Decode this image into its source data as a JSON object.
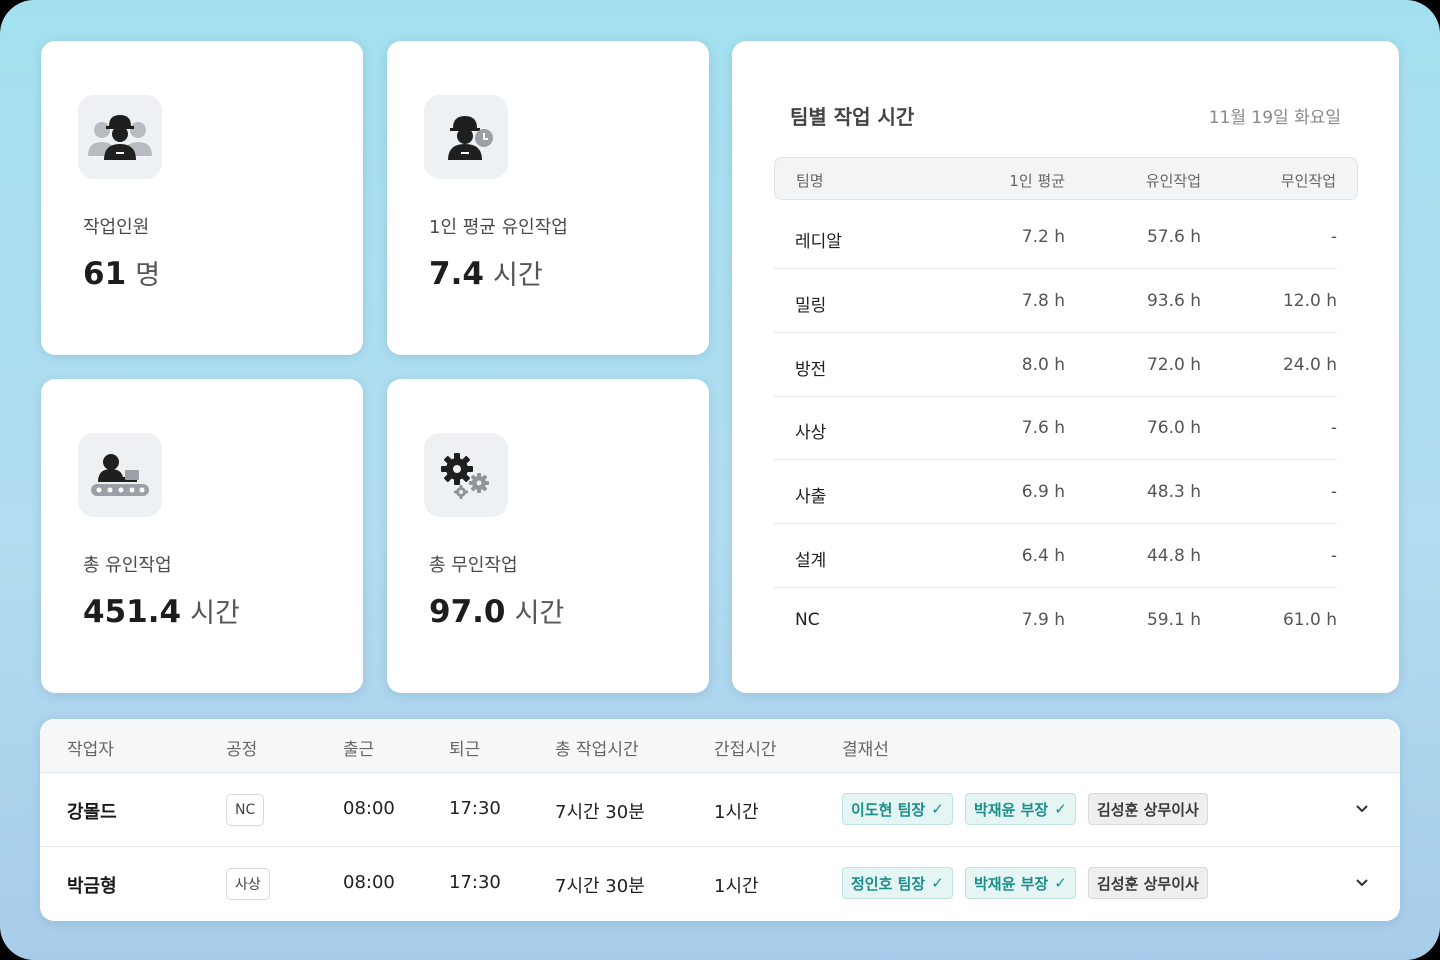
{
  "stats": [
    {
      "label": "작업인원",
      "value": "61",
      "unit": "명",
      "icon": "workers-group-icon"
    },
    {
      "label": "1인 평균 유인작업",
      "value": "7.4",
      "unit": "시간",
      "icon": "worker-clock-icon"
    },
    {
      "label": "총 유인작업",
      "value": "451.4",
      "unit": "시간",
      "icon": "worker-conveyor-icon"
    },
    {
      "label": "총 무인작업",
      "value": "97.0",
      "unit": "시간",
      "icon": "gears-icon"
    }
  ],
  "team_panel": {
    "title": "팀별 작업 시간",
    "date": "11월 19일 화요일",
    "headers": {
      "team": "팀명",
      "avg": "1인 평균",
      "manned": "유인작업",
      "unmanned": "무인작업"
    },
    "rows": [
      {
        "team": "레디알",
        "avg": "7.2  h",
        "manned": "57.6 h",
        "unmanned": "-"
      },
      {
        "team": "밀링",
        "avg": "7.8  h",
        "manned": "93.6 h",
        "unmanned": "12.0 h"
      },
      {
        "team": "방전",
        "avg": "8.0  h",
        "manned": "72.0 h",
        "unmanned": "24.0 h"
      },
      {
        "team": "사상",
        "avg": "7.6  h",
        "manned": "76.0 h",
        "unmanned": "-"
      },
      {
        "team": "사출",
        "avg": "6.9  h",
        "manned": "48.3 h",
        "unmanned": "-"
      },
      {
        "team": "설계",
        "avg": "6.4  h",
        "manned": "44.8 h",
        "unmanned": "-"
      },
      {
        "team": "NC",
        "avg": "7.9  h",
        "manned": "59.1 h",
        "unmanned": "61.0 h"
      }
    ]
  },
  "worker_table": {
    "headers": {
      "worker": "작업자",
      "process": "공정",
      "clock_in": "출근",
      "clock_out": "퇴근",
      "total": "총 작업시간",
      "indirect": "간접시간",
      "approval": "결재선"
    },
    "rows": [
      {
        "worker": "강몰드",
        "process": "NC",
        "clock_in": "08:00",
        "clock_out": "17:30",
        "total": "7시간 30분",
        "indirect": "1시간",
        "approvals": [
          {
            "name": "이도현 팀장",
            "status": "approved"
          },
          {
            "name": "박재윤 부장",
            "status": "approved"
          },
          {
            "name": "김성훈 상무이사",
            "status": "pending"
          }
        ]
      },
      {
        "worker": "박금형",
        "process": "사상",
        "clock_in": "08:00",
        "clock_out": "17:30",
        "total": "7시간 30분",
        "indirect": "1시간",
        "approvals": [
          {
            "name": "정인호 팀장",
            "status": "approved"
          },
          {
            "name": "박재윤 부장",
            "status": "approved"
          },
          {
            "name": "김성훈 상무이사",
            "status": "pending"
          }
        ]
      }
    ]
  },
  "colors": {
    "accent": "#1b8f8a",
    "accent_bg": "#e4f5f4",
    "pending_bg": "#eeeeee",
    "background": "#a8dcef"
  }
}
